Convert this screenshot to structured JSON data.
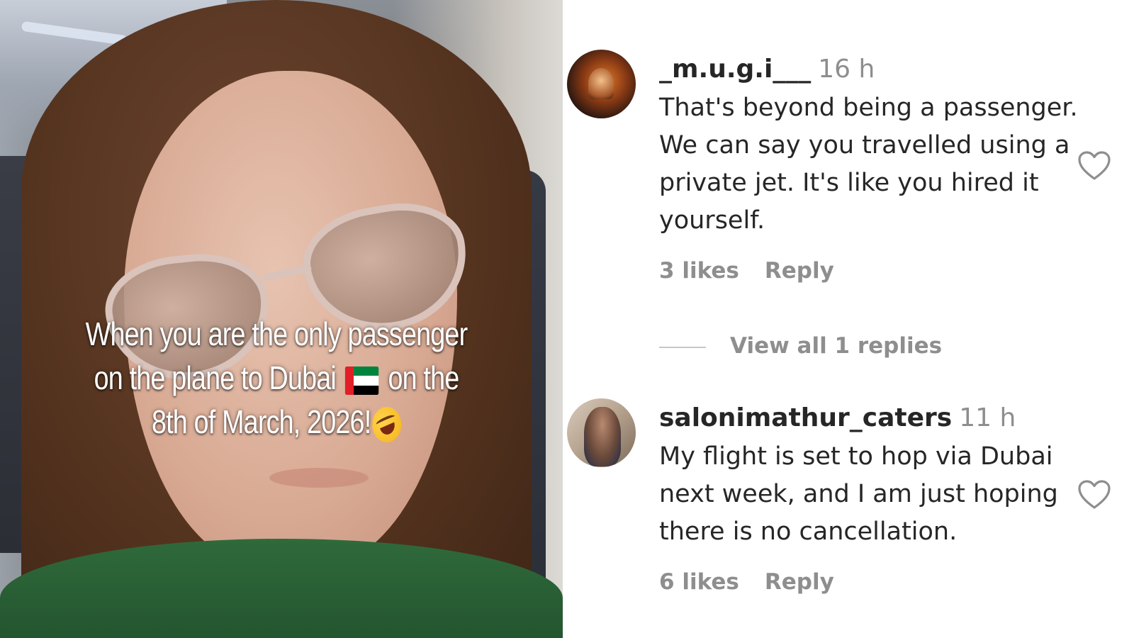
{
  "post": {
    "overlay_line_1": "When you are the only passenger",
    "overlay_line_2a": "on the plane to Dubai",
    "overlay_flag_icon": "uae-flag-icon",
    "overlay_line_2b": "on the",
    "overlay_line_3": "8th of March, 2026!",
    "overlay_emoji_icon": "rolling-on-floor-laughing-icon"
  },
  "comments": [
    {
      "username": "_m.u.g.i___",
      "time": "16 h",
      "text": "That's beyond being a passenger. We can say you travelled using a private jet. It's like you hired it yourself.",
      "likes": "3 likes",
      "reply_label": "Reply",
      "view_replies": "View all 1 replies"
    },
    {
      "username": "salonimathur_caters",
      "time": "11 h",
      "text": "My flight is set to hop via Dubai next week, and I am just hoping there is no cancellation.",
      "likes": "6 likes",
      "reply_label": "Reply"
    }
  ],
  "colors": {
    "username": "#262626",
    "secondary_text": "#8e8e8e",
    "divider_line": "#c7c7c7"
  }
}
